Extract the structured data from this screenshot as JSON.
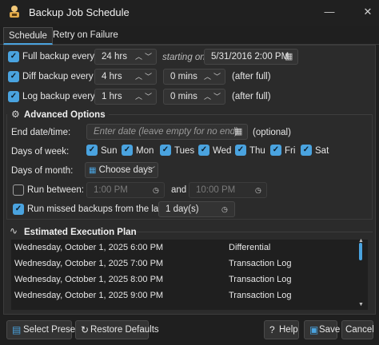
{
  "window": {
    "title": "Backup Job Schedule"
  },
  "tabs": [
    {
      "label": "Schedule"
    },
    {
      "label": "Retry on Failure"
    }
  ],
  "schedule": {
    "full": {
      "label": "Full backup every",
      "interval": "24 hrs",
      "starting_label": "starting on",
      "start": "5/31/2016 2:00 PM"
    },
    "diff": {
      "label": "Diff backup every",
      "interval": "4 hrs",
      "offset": "0 mins",
      "after": "(after full)"
    },
    "log": {
      "label": "Log backup every",
      "interval": "1 hrs",
      "offset": "0 mins",
      "after": "(after full)"
    }
  },
  "advanced": {
    "title": "Advanced Options",
    "end_label": "End date/time:",
    "end_placeholder": "Enter date (leave empty for no end)",
    "optional": "(optional)",
    "dow_label": "Days of week:",
    "days": [
      "Sun",
      "Mon",
      "Tues",
      "Wed",
      "Thu",
      "Fri",
      "Sat"
    ],
    "dom_label": "Days of month:",
    "dom_button": "Choose days",
    "between_label": "Run between:",
    "between_from": "1:00 PM",
    "between_and": "and",
    "between_to": "10:00 PM",
    "missed_label": "Run missed backups from the last:",
    "missed_value": "1 day(s)"
  },
  "plan": {
    "title": "Estimated Execution Plan",
    "rows": [
      {
        "date": "Wednesday, October 1, 2025 6:00 PM",
        "type": "Differential"
      },
      {
        "date": "Wednesday, October 1, 2025 7:00 PM",
        "type": "Transaction Log"
      },
      {
        "date": "Wednesday, October 1, 2025 8:00 PM",
        "type": "Transaction Log"
      },
      {
        "date": "Wednesday, October 1, 2025 9:00 PM",
        "type": "Transaction Log"
      }
    ]
  },
  "footer": {
    "select_preset": "Select Preset",
    "restore_defaults": "Restore Defaults",
    "help": "Help",
    "save": "Save",
    "cancel": "Cancel"
  },
  "colors": {
    "accent": "#4aa3df",
    "background": "#2b2b2b"
  }
}
